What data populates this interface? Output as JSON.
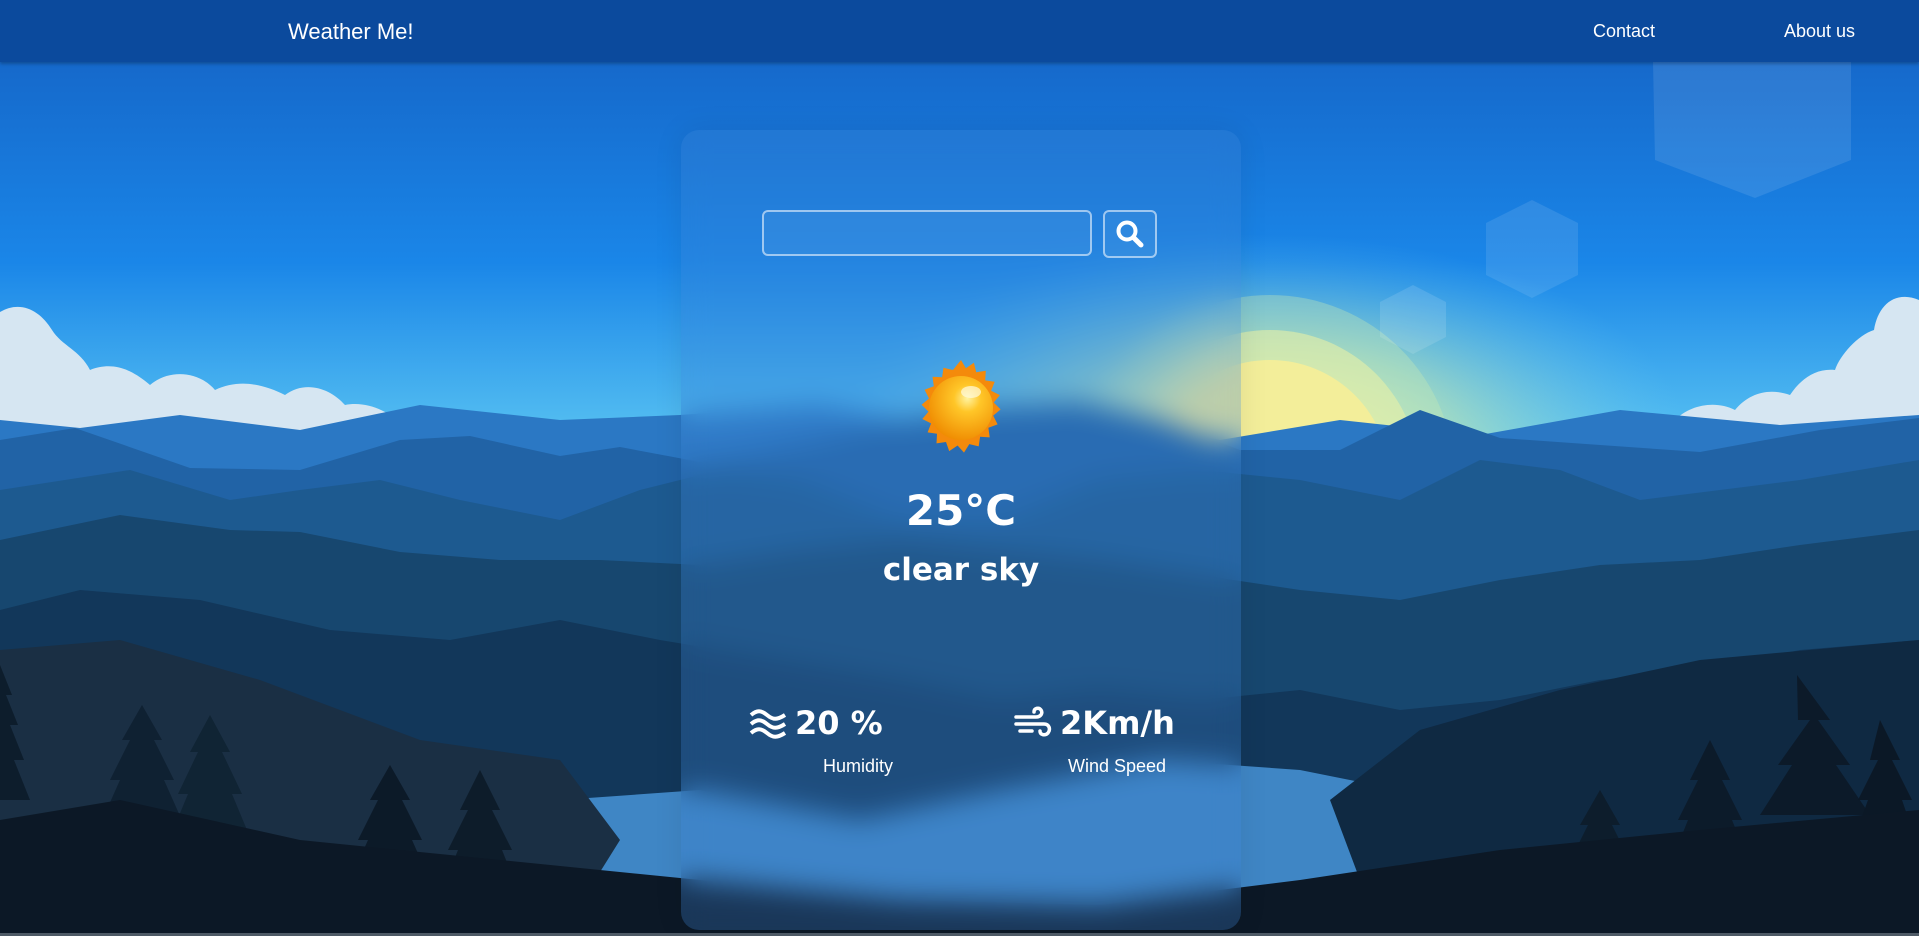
{
  "navbar": {
    "brand": "Weather Me!",
    "links": [
      "Contact",
      "About us"
    ]
  },
  "search": {
    "value": "",
    "placeholder": "",
    "button_icon": "search-icon"
  },
  "weather": {
    "icon": "sun-icon",
    "temperature": "25°C",
    "description": "clear sky"
  },
  "stats": {
    "humidity": {
      "icon": "waves-icon",
      "value": "20 %",
      "label": "Humidity"
    },
    "wind": {
      "icon": "wind-icon",
      "value": "2Km/h",
      "label": "Wind Speed"
    }
  },
  "colors": {
    "navbar": "#0b4a9d",
    "sky_top": "#1668c9",
    "sky_glow": "#7fd4f0",
    "sun": "#f3ee9a",
    "clouds": "#d6e6f2",
    "text": "#ffffff"
  }
}
